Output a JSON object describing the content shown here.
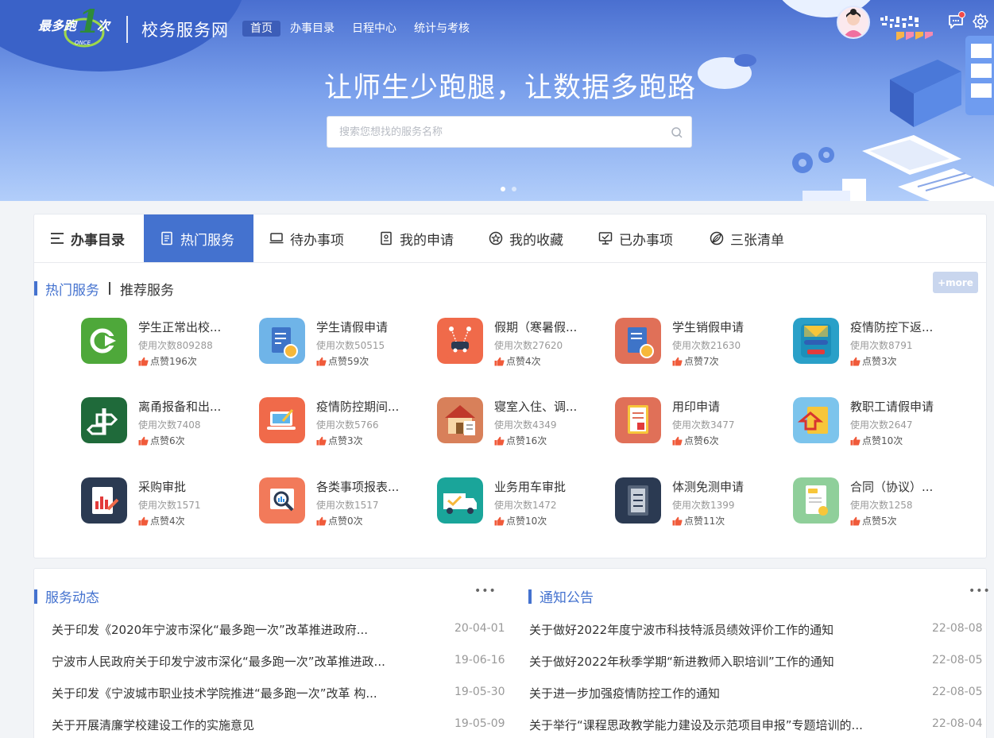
{
  "header": {
    "logo_text": "最多跑1次",
    "logo_sub": "ONCE",
    "site_title": "校务服务网",
    "nav": [
      "首页",
      "办事目录",
      "日程中心",
      "统计与考核"
    ],
    "active_nav": "首页"
  },
  "banner": {
    "slogan": "让师生少跑腿，让数据多跑路",
    "search_placeholder": "搜索您想找的服务名称"
  },
  "tabs": [
    "办事目录",
    "热门服务",
    "待办事项",
    "我的申请",
    "我的收藏",
    "已办事项",
    "三张清单"
  ],
  "sub_tabs": [
    "热门服务",
    "推荐服务"
  ],
  "more_label": "+more",
  "services": [
    {
      "name": "学生正常出校...",
      "usage": "使用次数809288",
      "likes": "点赞196次",
      "icon": "exit-icon",
      "color": "#4ea83a"
    },
    {
      "name": "学生请假申请",
      "usage": "使用次数50515",
      "likes": "点赞59次",
      "icon": "leave-form-icon",
      "color": "#6fb4e8"
    },
    {
      "name": "假期（寒暑假...",
      "usage": "使用次数27620",
      "likes": "点赞4次",
      "icon": "car-route-icon",
      "color": "#f06a4a"
    },
    {
      "name": "学生销假申请",
      "usage": "使用次数21630",
      "likes": "点赞7次",
      "icon": "cancel-leave-icon",
      "color": "#e07058"
    },
    {
      "name": "疫情防控下返...",
      "usage": "使用次数8791",
      "likes": "点赞3次",
      "icon": "envelope-submit-icon",
      "color": "#2aa0c8"
    },
    {
      "name": "离甬报备和出...",
      "usage": "使用次数7408",
      "likes": "点赞6次",
      "icon": "road-sign-icon",
      "color": "#1f6a3a"
    },
    {
      "name": "疫情防控期间...",
      "usage": "使用次数5766",
      "likes": "点赞3次",
      "icon": "laptop-edit-icon",
      "color": "#f06a4a"
    },
    {
      "name": "寝室入住、调...",
      "usage": "使用次数4349",
      "likes": "点赞16次",
      "icon": "dorm-house-icon",
      "color": "#d8805a"
    },
    {
      "name": "用印申请",
      "usage": "使用次数3477",
      "likes": "点赞6次",
      "icon": "seal-document-icon",
      "color": "#e07058"
    },
    {
      "name": "教职工请假申请",
      "usage": "使用次数2647",
      "likes": "点赞10次",
      "icon": "staff-leave-icon",
      "color": "#7cc4ec"
    },
    {
      "name": "采购审批",
      "usage": "使用次数1571",
      "likes": "点赞4次",
      "icon": "purchase-chart-icon",
      "color": "#2b3a52"
    },
    {
      "name": "各类事项报表...",
      "usage": "使用次数1517",
      "likes": "点赞0次",
      "icon": "report-magnifier-icon",
      "color": "#f27a5a"
    },
    {
      "name": "业务用车审批",
      "usage": "使用次数1472",
      "likes": "点赞10次",
      "icon": "truck-icon",
      "color": "#1aa59a"
    },
    {
      "name": "体测免测申请",
      "usage": "使用次数1399",
      "likes": "点赞11次",
      "icon": "fitness-test-icon",
      "color": "#2b3a52"
    },
    {
      "name": "合同（协议）...",
      "usage": "使用次数1258",
      "likes": "点赞5次",
      "icon": "contract-icon",
      "color": "#8fcf9a"
    }
  ],
  "news": {
    "title": "服务动态",
    "items": [
      {
        "title": "关于印发《2020年宁波市深化“最多跑一次”改革推进政府...",
        "date": "20-04-01"
      },
      {
        "title": "宁波市人民政府关于印发宁波市深化“最多跑一次”改革推进政...",
        "date": "19-06-16"
      },
      {
        "title": "关于印发《宁波城市职业技术学院推进“最多跑一次”改革 构...",
        "date": "19-05-30"
      },
      {
        "title": "关于开展清廉学校建设工作的实施意见",
        "date": "19-05-09"
      }
    ]
  },
  "notices": {
    "title": "通知公告",
    "items": [
      {
        "title": "关于做好2022年度宁波市科技特派员绩效评价工作的通知",
        "date": "22-08-08"
      },
      {
        "title": "关于做好2022年秋季学期“新进教师入职培训”工作的通知",
        "date": "22-08-05"
      },
      {
        "title": "关于进一步加强疫情防控工作的通知",
        "date": "22-08-05"
      },
      {
        "title": "关于举行“课程思政教学能力建设及示范项目申报”专题培训的...",
        "date": "22-08-04"
      }
    ]
  },
  "more_dots": "•••",
  "accent_color": "#4472cf"
}
